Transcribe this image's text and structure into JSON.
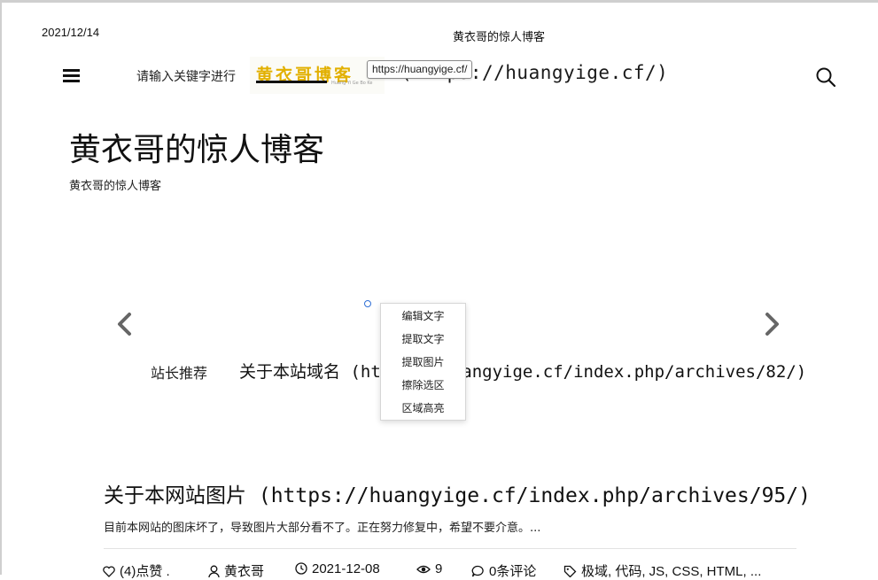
{
  "print_header": {
    "date": "2021/12/14",
    "title": "黄衣哥的惊人博客"
  },
  "header": {
    "menu_icon": "hamburger-icon",
    "search_hint": "请输入关键字进行",
    "logo_text": "黄衣哥博客",
    "logo_subtext": "Huang Yi Ge Bo Ke",
    "url_tooltip": "https://huangyige.cf/",
    "site_url_text": "(https://huangyige.cf/)",
    "search_icon": "search-icon"
  },
  "site": {
    "title": "黄衣哥的惊人博客",
    "subtitle": "黄衣哥的惊人博客"
  },
  "slider": {
    "prev_icon": "chevron-left-icon",
    "next_icon": "chevron-right-icon",
    "tag": "站长推荐",
    "title": "关于本站域名 (https://huangyige.cf/index.php/archives/82/)"
  },
  "context_menu": {
    "items": [
      "编辑文字",
      "提取文字",
      "提取图片",
      "擦除选区",
      "区域高亮"
    ]
  },
  "post": {
    "title": "关于本网站图片 (https://huangyige.cf/index.php/archives/95/)",
    "excerpt": "目前本网站的图床坏了，导致图片大部分看不了。正在努力修复中，希望不要介意。...",
    "meta": {
      "likes": "(4)点赞 .",
      "author": "黄衣哥",
      "date": "2021-12-08",
      "views": "9",
      "comments": "0条评论",
      "tags": "极域, 代码, JS, CSS, HTML, ..."
    }
  }
}
